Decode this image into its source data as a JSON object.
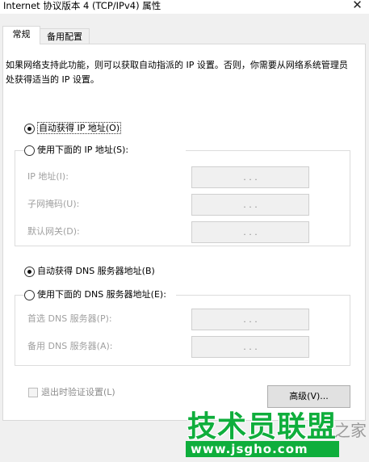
{
  "window": {
    "title": "Internet 协议版本 4 (TCP/IPv4) 属性",
    "close_glyph": "✕"
  },
  "tabs": [
    {
      "label": "常规",
      "selected": true
    },
    {
      "label": "备用配置",
      "selected": false
    }
  ],
  "intro_text": "如果网络支持此功能，则可以获取自动指派的 IP 设置。否则，你需要从网络系统管理员处获得适当的 IP 设置。",
  "ip_section": {
    "auto": {
      "label": "自动获得 IP 地址(O)",
      "checked": true
    },
    "manual": {
      "label": "使用下面的 IP 地址(S):",
      "checked": false
    },
    "fields": [
      {
        "label": "IP 地址(I):",
        "value": ".   .   ."
      },
      {
        "label": "子网掩码(U):",
        "value": ".   .   ."
      },
      {
        "label": "默认网关(D):",
        "value": ".   .   ."
      }
    ]
  },
  "dns_section": {
    "auto": {
      "label": "自动获得 DNS 服务器地址(B)",
      "checked": true
    },
    "manual": {
      "label": "使用下面的 DNS 服务器地址(E):",
      "checked": false
    },
    "fields": [
      {
        "label": "首选 DNS 服务器(P):",
        "value": ".   .   ."
      },
      {
        "label": "备用 DNS 服务器(A):",
        "value": ".   .   ."
      }
    ]
  },
  "validate_checkbox": {
    "label": "退出时验证设置(L)",
    "checked": false,
    "enabled": false
  },
  "advanced_button": {
    "label": "高级(V)..."
  },
  "watermark": {
    "main": "技术员联盟",
    "url": "www.jsgho.com",
    "right": "之家"
  },
  "colors": {
    "watermark_green": "#0fae3c",
    "disabled_text": "#a0a0a0"
  }
}
